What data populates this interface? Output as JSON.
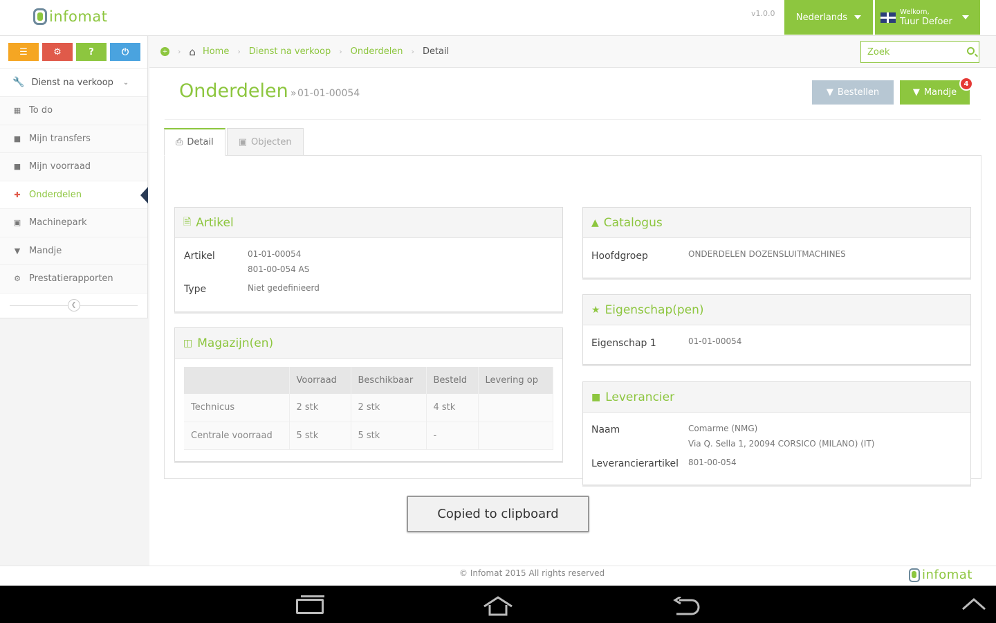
{
  "header": {
    "logo_text": "infomat",
    "version": "v1.0.0",
    "language": "Nederlands",
    "user_welcome": "Welkom,",
    "user_name": "Tuur Defoer"
  },
  "sidebar": {
    "shortcuts": [
      {
        "icon": "users-icon",
        "glyph": "☰",
        "color": "#f5a623"
      },
      {
        "icon": "cogs-icon",
        "glyph": "⚙",
        "color": "#e05a4a"
      },
      {
        "icon": "help-icon",
        "glyph": "?",
        "color": "#8dc63f"
      },
      {
        "icon": "power-icon",
        "glyph": "⏻",
        "color": "#4aa3df"
      }
    ],
    "section_label": "Dienst na verkoop",
    "items": [
      {
        "label": "To do",
        "icon": "calendar-icon"
      },
      {
        "label": "Mijn transfers",
        "icon": "truck-icon"
      },
      {
        "label": "Mijn voorraad",
        "icon": "briefcase-icon"
      },
      {
        "label": "Onderdelen",
        "icon": "wrench-icon"
      },
      {
        "label": "Machinepark",
        "icon": "machine-icon"
      },
      {
        "label": "Mandje",
        "icon": "cart-icon"
      },
      {
        "label": "Prestatierapporten",
        "icon": "cogs-icon"
      }
    ],
    "active_item": "Onderdelen"
  },
  "breadcrumb": [
    "Home",
    "Dienst na verkoop",
    "Onderdelen",
    "Detail"
  ],
  "search": {
    "placeholder": "Zoek",
    "value": ""
  },
  "page": {
    "title": "Onderdelen",
    "subtitle": "01-01-00054",
    "order_button": "Bestellen",
    "cart_button": "Mandje",
    "cart_count": "4"
  },
  "tabs": [
    "Detail",
    "Objecten"
  ],
  "active_tab": "Detail",
  "artikel": {
    "heading": "Artikel",
    "artikel_label": "Artikel",
    "artikel_line1": "01-01-00054",
    "artikel_line2": "801-00-054 AS",
    "type_label": "Type",
    "type_value": "Niet gedefinieerd"
  },
  "magazijn": {
    "heading": "Magazijn(en)",
    "columns": [
      "",
      "Voorraad",
      "Beschikbaar",
      "Besteld",
      "Levering op"
    ],
    "rows": [
      [
        "Technicus",
        "2 stk",
        "2 stk",
        "4 stk",
        ""
      ],
      [
        "Centrale voorraad",
        "5 stk",
        "5 stk",
        "-",
        ""
      ]
    ]
  },
  "catalogus": {
    "heading": "Catalogus",
    "label": "Hoofdgroep",
    "value": "ONDERDELEN DOZENSLUITMACHINES"
  },
  "eigenschappen": {
    "heading": "Eigenschap(pen)",
    "label": "Eigenschap 1",
    "value": "01-01-00054"
  },
  "leverancier": {
    "heading": "Leverancier",
    "naam_label": "Naam",
    "naam_line1": "Comarme (NMG)",
    "naam_line2": "Via Q. Sella 1, 20094 CORSICO (MILANO) (IT)",
    "artikel_label": "Leverancierartikel",
    "artikel_value": "801-00-054"
  },
  "toast": "Copied to clipboard",
  "footer": {
    "copyright": "© Infomat 2015 All rights reserved",
    "logo_text": "infomat"
  },
  "colors": {
    "brand_green": "#8dc63f",
    "logo_gray": "#6e8a9c",
    "badge_red": "#e53935",
    "active_arrow": "#2a3b55"
  }
}
